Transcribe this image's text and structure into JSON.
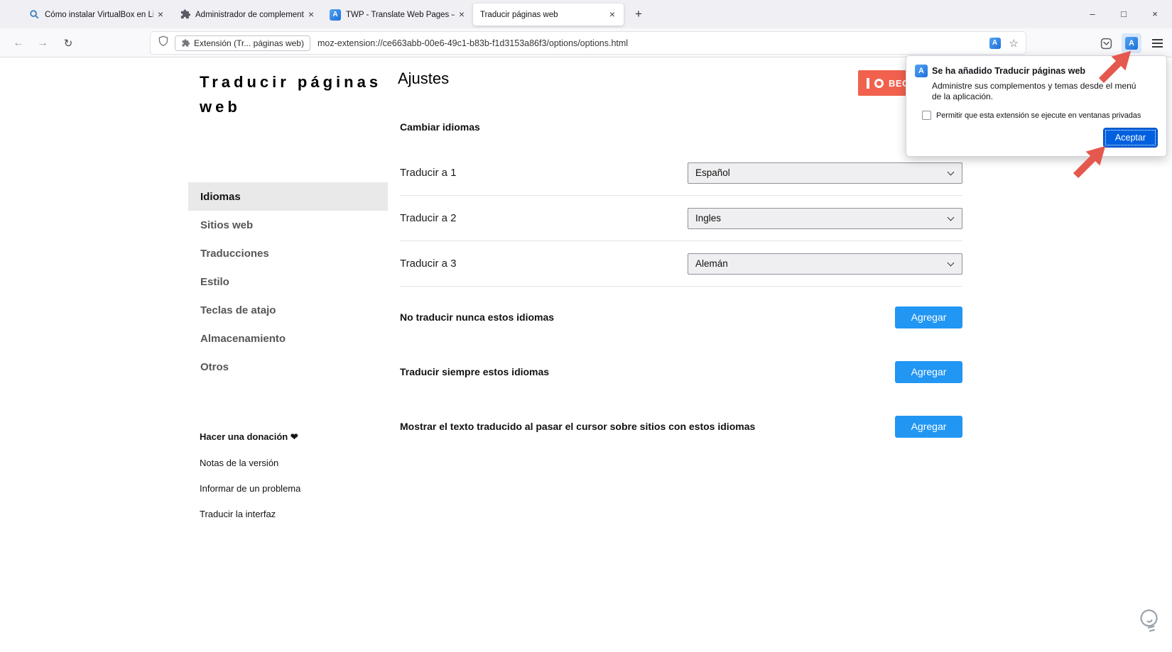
{
  "tab_bar": {
    "tabs": [
      {
        "title": "Cómo instalar VirtualBox en Lin"
      },
      {
        "title": "Administrador de complemento"
      },
      {
        "title": "TWP - Translate Web Pages – C"
      },
      {
        "title": "Traducir páginas web"
      }
    ]
  },
  "icons": {
    "tab_close": "×",
    "new_tab": "+",
    "back": "←",
    "forward": "→",
    "reload": "↻",
    "star": "☆",
    "translate_glyph": "A",
    "minimize": "–",
    "maximize": "□",
    "window_close": "×"
  },
  "toolbar": {
    "identity_chip": "Extensión (Tr... páginas web)",
    "url": "moz-extension://ce663abb-00e6-49c1-b83b-f1d3153a86f3/options/options.html"
  },
  "doorhanger": {
    "title": "Se ha añadido Traducir páginas web",
    "body": "Administre sus complementos y temas desde el menú de la aplicación.",
    "checkbox_label": "Permitir que esta extensión se ejecute en ventanas privadas",
    "accept_button": "Aceptar"
  },
  "sidebar": {
    "brand": "Traducir páginas web",
    "items": [
      {
        "label": "Idiomas",
        "selected": true
      },
      {
        "label": "Sitios web"
      },
      {
        "label": "Traducciones"
      },
      {
        "label": "Estilo"
      },
      {
        "label": "Teclas de atajo"
      },
      {
        "label": "Almacenamiento"
      },
      {
        "label": "Otros"
      }
    ],
    "links": [
      {
        "label": "Hacer una donación ❤"
      },
      {
        "label": "Notas de la versión"
      },
      {
        "label": "Informar de un problema"
      },
      {
        "label": "Traducir la interfaz"
      }
    ]
  },
  "main": {
    "heading": "Ajustes",
    "patreon_button": "BECO",
    "section_heading": "Cambiar idiomas",
    "language_rows": [
      {
        "label": "Traducir a 1",
        "value": "Español"
      },
      {
        "label": "Traducir a 2",
        "value": "Ingles"
      },
      {
        "label": "Traducir a 3",
        "value": "Alemán"
      }
    ],
    "action_rows": [
      {
        "label": "No traducir nunca estos idiomas",
        "button": "Agregar"
      },
      {
        "label": "Traducir siempre estos idiomas",
        "button": "Agregar"
      },
      {
        "label": "Mostrar el texto traducido al pasar el cursor sobre sitios con estos idiomas",
        "button": "Agregar"
      }
    ]
  },
  "colors": {
    "accent_blue": "#2196f3",
    "firefox_primary": "#0060df",
    "patreon_red": "#f2614d",
    "arrow_red": "#e4584d"
  }
}
